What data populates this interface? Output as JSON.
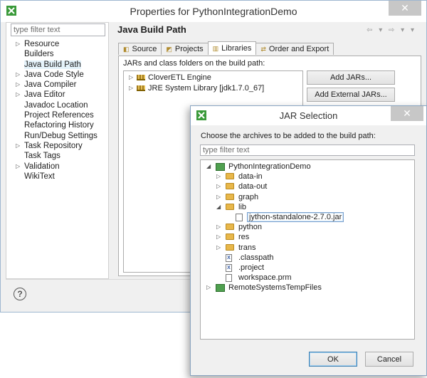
{
  "properties_window": {
    "title": "Properties for PythonIntegrationDemo",
    "close_label": "✕",
    "filter_placeholder": "type filter text",
    "nav_items": [
      {
        "label": "Resource",
        "expandable": true
      },
      {
        "label": "Builders",
        "expandable": false
      },
      {
        "label": "Java Build Path",
        "expandable": false,
        "selected": true
      },
      {
        "label": "Java Code Style",
        "expandable": true
      },
      {
        "label": "Java Compiler",
        "expandable": true
      },
      {
        "label": "Java Editor",
        "expandable": true
      },
      {
        "label": "Javadoc Location",
        "expandable": false
      },
      {
        "label": "Project References",
        "expandable": false
      },
      {
        "label": "Refactoring History",
        "expandable": false
      },
      {
        "label": "Run/Debug Settings",
        "expandable": false
      },
      {
        "label": "Task Repository",
        "expandable": true
      },
      {
        "label": "Task Tags",
        "expandable": false
      },
      {
        "label": "Validation",
        "expandable": true
      },
      {
        "label": "WikiText",
        "expandable": false
      }
    ],
    "page_title": "Java Build Path",
    "nav_arrows": "⇦ ▾ ⇨ ▾ ▾",
    "tabs": [
      {
        "label": "Source",
        "active": false
      },
      {
        "label": "Projects",
        "active": false
      },
      {
        "label": "Libraries",
        "active": true
      },
      {
        "label": "Order and Export",
        "active": false
      }
    ],
    "build_path_label": "JARs and class folders on the build path:",
    "libraries": [
      {
        "label": "CloverETL Engine"
      },
      {
        "label": "JRE System Library [jdk1.7.0_67]"
      }
    ],
    "buttons": {
      "add_jars": "Add JARs...",
      "add_external_jars": "Add External JARs..."
    },
    "help_label": "?"
  },
  "jar_dialog": {
    "title": "JAR Selection",
    "close_label": "✕",
    "instruction": "Choose the archives to be added to the build path:",
    "filter_placeholder": "type filter text",
    "tree": [
      {
        "label": "PythonIntegrationDemo",
        "depth": 0,
        "twisty": "◢",
        "icon": "project"
      },
      {
        "label": "data-in",
        "depth": 1,
        "twisty": "▷",
        "icon": "folder"
      },
      {
        "label": "data-out",
        "depth": 1,
        "twisty": "▷",
        "icon": "folder"
      },
      {
        "label": "graph",
        "depth": 1,
        "twisty": "▷",
        "icon": "folder"
      },
      {
        "label": "lib",
        "depth": 1,
        "twisty": "◢",
        "icon": "folder"
      },
      {
        "label": "jython-standalone-2.7.0.jar",
        "depth": 2,
        "twisty": "",
        "icon": "jar",
        "selected": true
      },
      {
        "label": "python",
        "depth": 1,
        "twisty": "▷",
        "icon": "folder"
      },
      {
        "label": "res",
        "depth": 1,
        "twisty": "▷",
        "icon": "folder"
      },
      {
        "label": "trans",
        "depth": 1,
        "twisty": "▷",
        "icon": "folder"
      },
      {
        "label": ".classpath",
        "depth": 1,
        "twisty": "",
        "icon": "file-x"
      },
      {
        "label": ".project",
        "depth": 1,
        "twisty": "",
        "icon": "file-x"
      },
      {
        "label": "workspace.prm",
        "depth": 1,
        "twisty": "",
        "icon": "file"
      },
      {
        "label": "RemoteSystemsTempFiles",
        "depth": 0,
        "twisty": "▷",
        "icon": "project"
      }
    ],
    "ok_label": "OK",
    "cancel_label": "Cancel"
  }
}
